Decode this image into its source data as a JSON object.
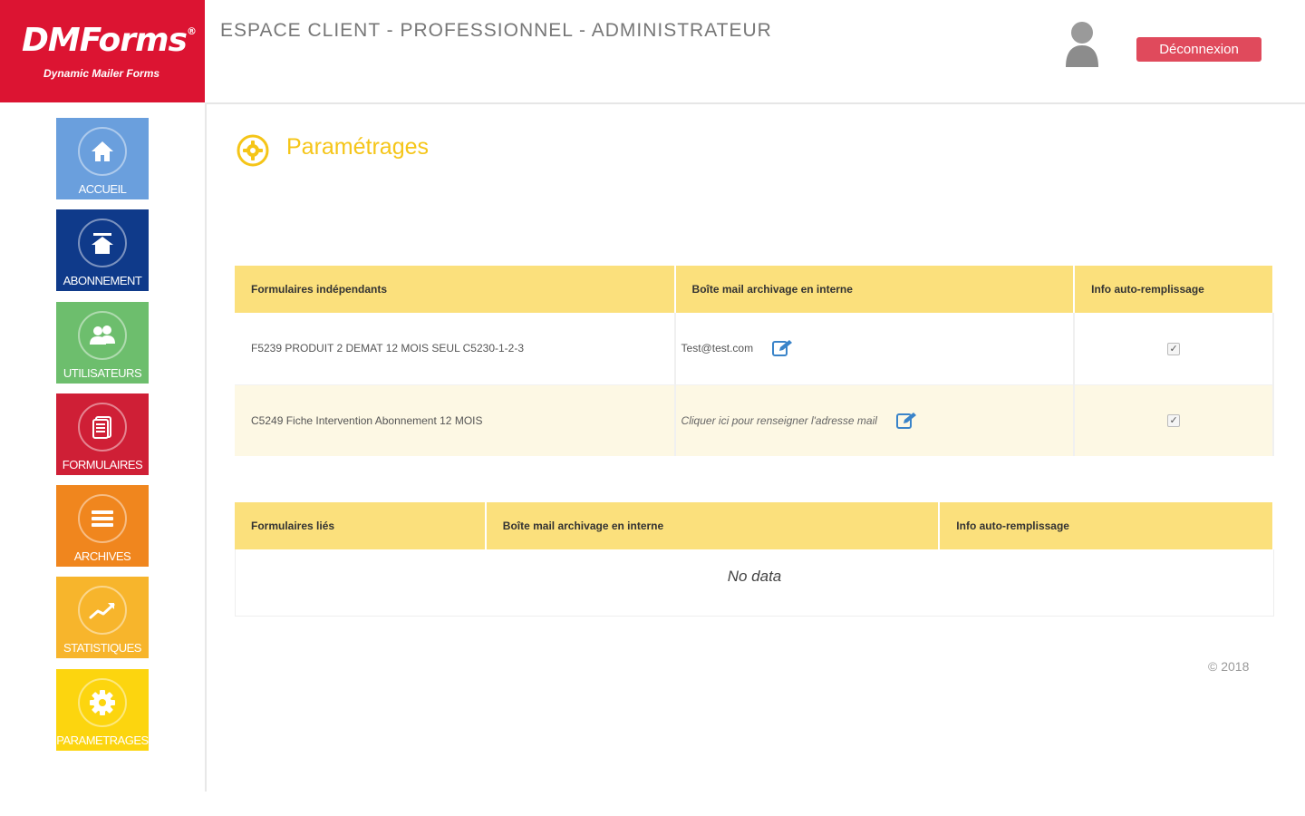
{
  "brand": {
    "name": "DMForms",
    "registered": "®",
    "tagline": "Dynamic Mailer Forms",
    "color": "#dc1432"
  },
  "header": {
    "title": "ESPACE CLIENT - PROFESSIONNEL - ADMINISTRATEUR",
    "logout_label": "Déconnexion"
  },
  "sidebar": {
    "items": [
      {
        "label": "ACCUEIL",
        "icon": "home-icon",
        "color": "#6a9fdd"
      },
      {
        "label": "ABONNEMENT",
        "icon": "subscription-icon",
        "color": "#0f3a8a"
      },
      {
        "label": "UTILISATEURS",
        "icon": "users-icon",
        "color": "#6dbe6d"
      },
      {
        "label": "FORMULAIRES",
        "icon": "forms-icon",
        "color": "#cf1f36"
      },
      {
        "label": "ARCHIVES",
        "icon": "archives-icon",
        "color": "#f0861e"
      },
      {
        "label": "STATISTIQUES",
        "icon": "statistics-icon",
        "color": "#f7b52c"
      },
      {
        "label": "PARAMETRAGES",
        "icon": "gear-icon",
        "color": "#fcd50f"
      }
    ]
  },
  "page": {
    "title": "Paramétrages",
    "accent": "#f5c518"
  },
  "independent_table": {
    "headers": [
      "Formulaires indépendants",
      "Boîte mail archivage en interne",
      "Info auto-remplissage"
    ],
    "rows": [
      {
        "form": "F5239 PRODUIT 2 DEMAT 12 MOIS SEUL C5230-1-2-3",
        "mail": "Test@test.com",
        "mail_is_placeholder": false,
        "autofill_checked": true
      },
      {
        "form": "C5249 Fiche Intervention Abonnement 12 MOIS",
        "mail": "Cliquer ici pour renseigner l'adresse mail",
        "mail_is_placeholder": true,
        "autofill_checked": true
      }
    ]
  },
  "linked_table": {
    "headers": [
      "Formulaires liés",
      "Boîte mail archivage en interne",
      "Info auto-remplissage"
    ],
    "empty_text": "No data"
  },
  "footer": {
    "copyright": "© 2018"
  }
}
